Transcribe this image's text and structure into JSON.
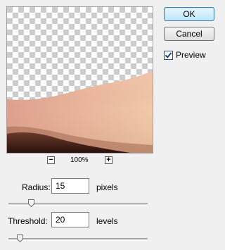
{
  "buttons": {
    "ok": "OK",
    "cancel": "Cancel"
  },
  "preview": {
    "label": "Preview",
    "checked": true
  },
  "zoom": {
    "level": "100%",
    "zoom_out_icon": "minus",
    "zoom_in_icon": "plus"
  },
  "radius": {
    "label": "Radius:",
    "value": "15",
    "unit": "pixels",
    "slider_fraction": 0.16
  },
  "threshold": {
    "label": "Threshold:",
    "value": "20",
    "unit": "levels",
    "slider_fraction": 0.08
  }
}
